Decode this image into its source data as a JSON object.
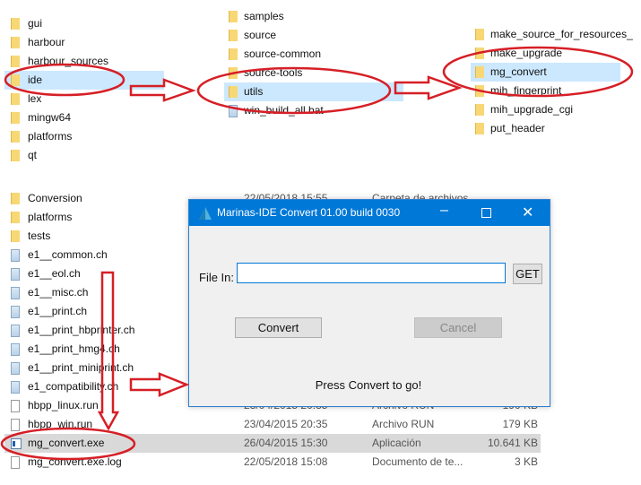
{
  "pane_left": {
    "items": [
      "gui",
      "harbour",
      "harbour_sources",
      "ide",
      "lex",
      "mingw64",
      "platforms",
      "qt"
    ],
    "selected": "ide"
  },
  "pane_middle": {
    "items": [
      "samples",
      "source",
      "source-common",
      "source-tools",
      "utils",
      "win_build_all.bat"
    ],
    "selected": "utils"
  },
  "pane_right": {
    "items": [
      "make_source_for_resources_",
      "make_upgrade",
      "mg_convert",
      "mih_fingerprint",
      "mih_upgrade_cgi",
      "put_header"
    ],
    "selected": "mg_convert"
  },
  "file_list": [
    {
      "name": "Conversion",
      "icon": "folder-icon",
      "date": "22/05/2018 15:55",
      "type": "Carpeta de archivos",
      "size": ""
    },
    {
      "name": "platforms",
      "icon": "folder-icon",
      "date": "",
      "type": "",
      "size": ""
    },
    {
      "name": "tests",
      "icon": "folder-icon",
      "date": "",
      "type": "",
      "size": ""
    },
    {
      "name": "e1__common.ch",
      "icon": "document-icon",
      "date": "",
      "type": "",
      "size": ""
    },
    {
      "name": "e1__eol.ch",
      "icon": "document-icon",
      "date": "",
      "type": "",
      "size": ""
    },
    {
      "name": "e1__misc.ch",
      "icon": "document-icon",
      "date": "",
      "type": "",
      "size": ""
    },
    {
      "name": "e1__print.ch",
      "icon": "document-icon",
      "date": "",
      "type": "",
      "size": ""
    },
    {
      "name": "e1__print_hbprinter.ch",
      "icon": "document-icon",
      "date": "",
      "type": "",
      "size": ""
    },
    {
      "name": "e1__print_hmg4.ch",
      "icon": "document-icon",
      "date": "",
      "type": "",
      "size": ""
    },
    {
      "name": "e1__print_miniprint.ch",
      "icon": "document-icon",
      "date": "",
      "type": "",
      "size": ""
    },
    {
      "name": "e1_compatibility.ch",
      "icon": "document-icon",
      "date": "",
      "type": "",
      "size": ""
    },
    {
      "name": "hbpp_linux.run",
      "icon": "file-icon",
      "date": "23/04/2015 20:35",
      "type": "Archivo RUN",
      "size": "190 KB"
    },
    {
      "name": "hbpp_win.run",
      "icon": "file-icon",
      "date": "23/04/2015 20:35",
      "type": "Archivo RUN",
      "size": "179 KB"
    },
    {
      "name": "mg_convert.exe",
      "icon": "exe-icon",
      "date": "26/04/2015 15:30",
      "type": "Aplicación",
      "size": "10.641 KB",
      "selected": true
    },
    {
      "name": "mg_convert.exe.log",
      "icon": "text-file-icon",
      "date": "22/05/2018 15:08",
      "type": "Documento de te...",
      "size": "3 KB"
    }
  ],
  "dialog": {
    "title": "Marinas-IDE Convert 01.00 build 0030",
    "file_in_label": "File In:",
    "file_in_value": "",
    "get_label": "GET",
    "convert_label": "Convert",
    "cancel_label": "Cancel",
    "status": "Press Convert to go!"
  },
  "colors": {
    "titlebar": "#0078d7",
    "annotation": "#d61f26",
    "selection": "#cce8ff"
  }
}
